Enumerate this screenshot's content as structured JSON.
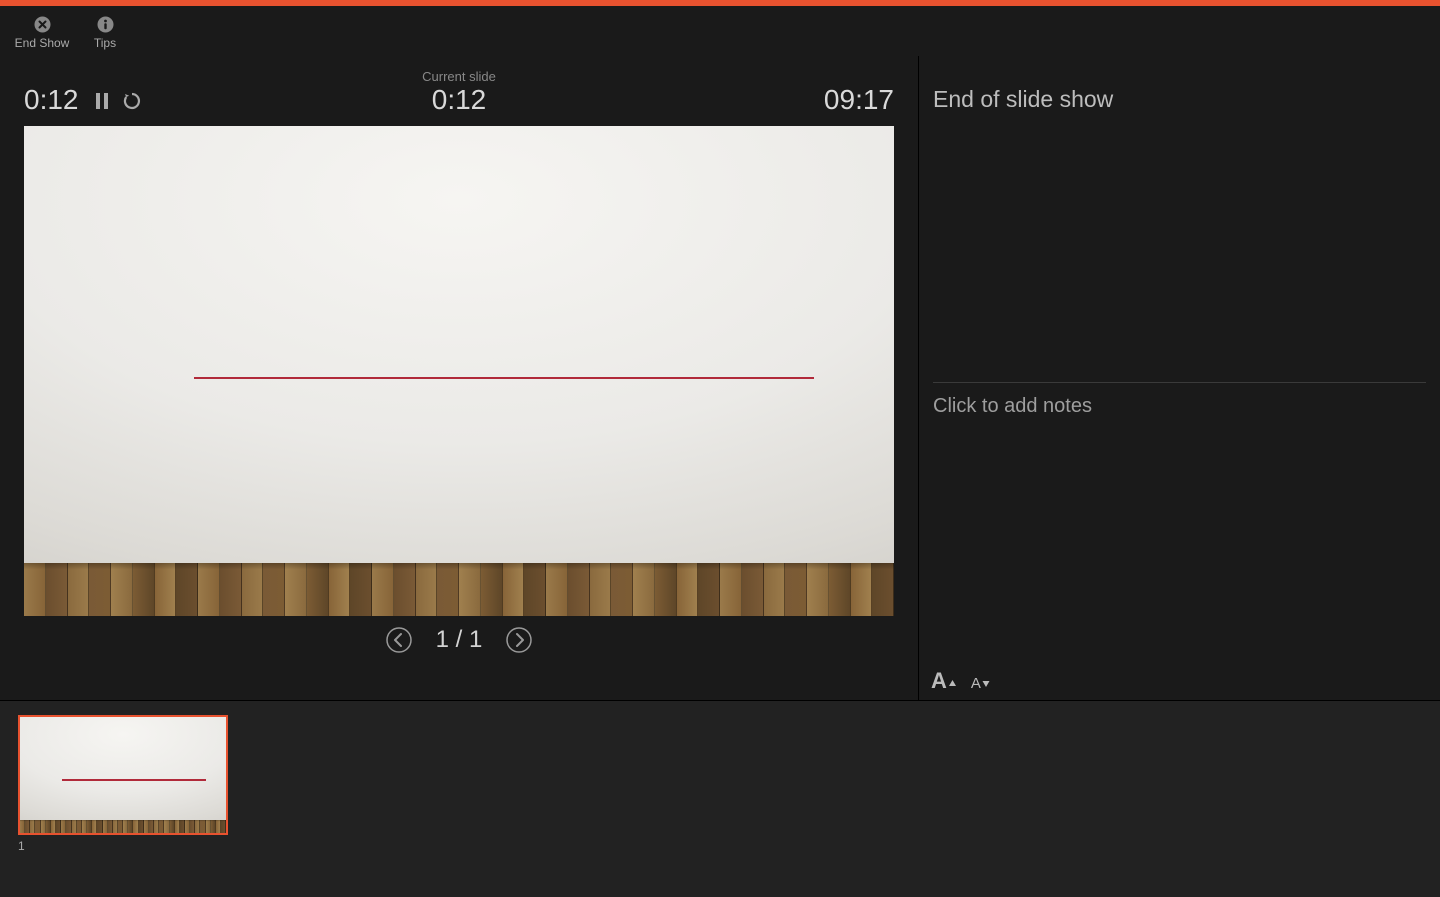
{
  "toolbar": {
    "end_show_label": "End Show",
    "tips_label": "Tips"
  },
  "timers": {
    "elapsed": "0:12",
    "current_slide_label": "Current slide",
    "current_slide_time": "0:12",
    "clock": "09:17"
  },
  "navigation": {
    "slide_counter": "1 / 1"
  },
  "next_slide": {
    "title": "End of slide show"
  },
  "notes": {
    "placeholder": "Click to add notes"
  },
  "font_controls": {
    "increase_label": "A",
    "decrease_label": "A"
  },
  "thumbnails": [
    {
      "index": "1"
    }
  ],
  "colors": {
    "accent": "#e8522f",
    "slide_line": "#b12a3a"
  }
}
